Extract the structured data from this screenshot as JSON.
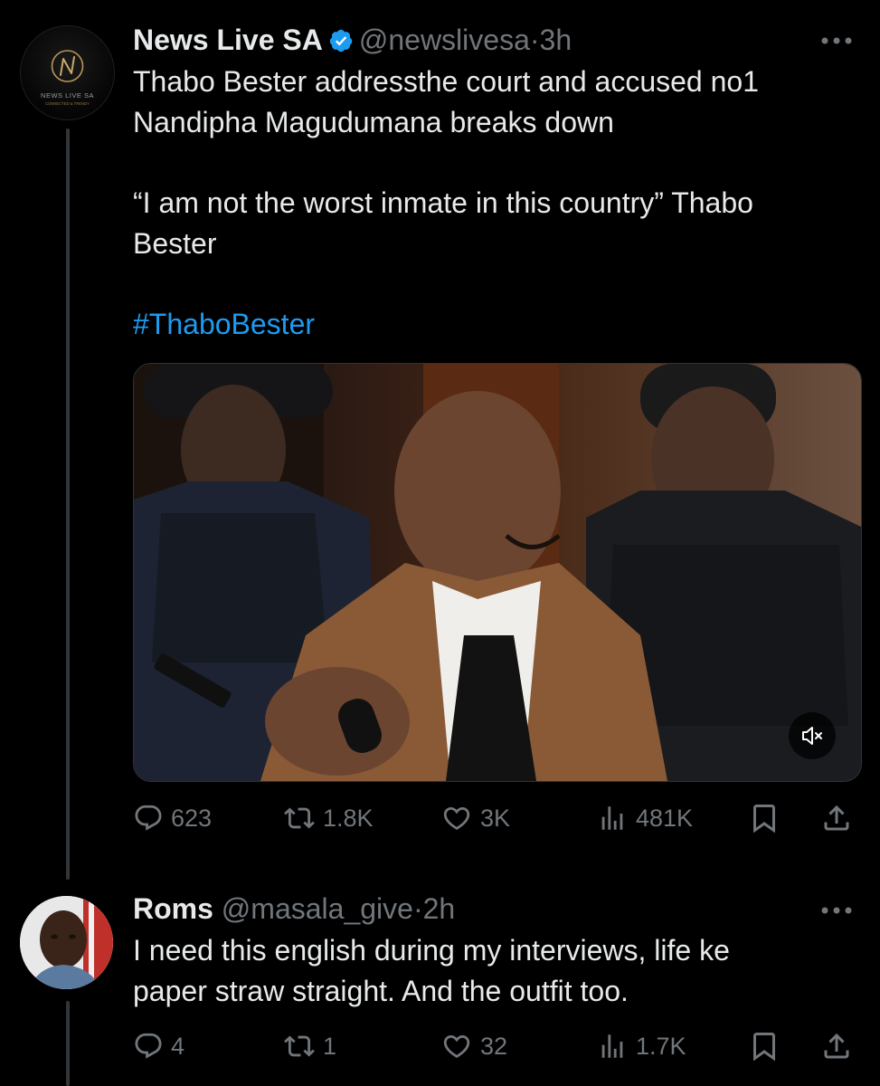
{
  "main_tweet": {
    "avatar": {
      "logo_text": "NEWS LIVE SA",
      "sub_text": "CONNECTED & TRENDY"
    },
    "display_name": "News Live SA",
    "verified": true,
    "handle": "@newslivesa",
    "separator": "·",
    "time": "3h",
    "text_line1": "Thabo Bester addressthe court and accused no1",
    "text_line2": "Nandipha Magudumana breaks down",
    "quote_line1": "“I am not the worst inmate in this country” Thabo",
    "quote_line2": "Bester",
    "hashtag": "#ThaboBester",
    "media": {
      "type": "video",
      "muted": true
    },
    "actions": {
      "replies": "623",
      "reposts": "1.8K",
      "likes": "3K",
      "views": "481K"
    }
  },
  "reply_tweet": {
    "display_name": "Roms",
    "handle": "@masala_give",
    "separator": "·",
    "time": "2h",
    "text_line1": "I need this english during my interviews, life ke",
    "text_line2": "paper straw straight. And the outfit too.",
    "actions": {
      "replies": "4",
      "reposts": "1",
      "likes": "32",
      "views": "1.7K"
    }
  },
  "colors": {
    "background": "#000000",
    "text": "#e7e9ea",
    "secondary": "#71767b",
    "accent": "#1d9bf0",
    "thread_line": "#333639"
  },
  "icons": [
    "verified-badge-icon",
    "more-icon",
    "reply-icon",
    "repost-icon",
    "like-icon",
    "views-icon",
    "bookmark-icon",
    "share-icon",
    "volume-muted-icon"
  ]
}
